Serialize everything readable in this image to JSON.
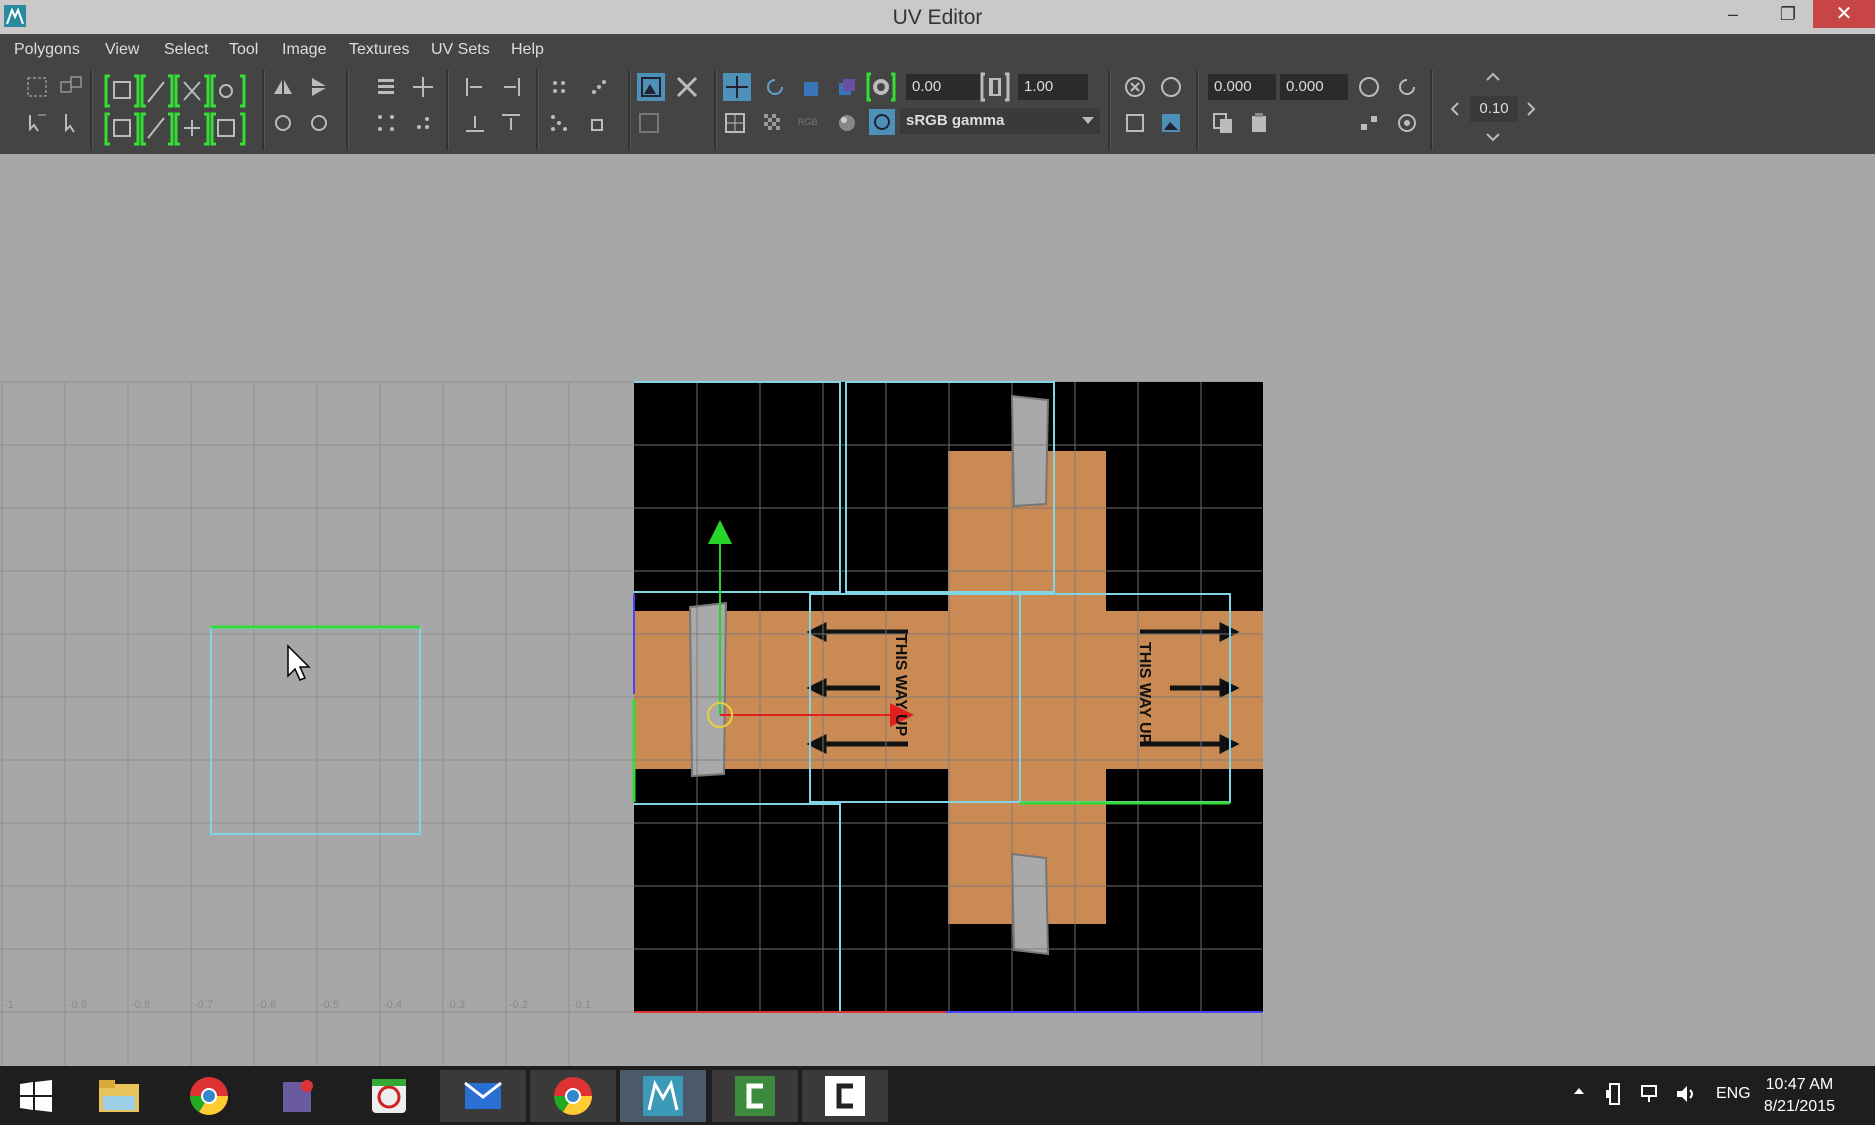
{
  "window": {
    "title": "UV Editor",
    "minimize": "–",
    "restore": "❐",
    "close": "✕"
  },
  "menu": [
    "Polygons",
    "View",
    "Select",
    "Tool",
    "Image",
    "Textures",
    "UV Sets",
    "Help"
  ],
  "toolbar": {
    "exposure_value": "0.00",
    "gamma_value": "1.00",
    "color_space": "sRGB gamma",
    "u_value": "0.000",
    "v_value": "0.000",
    "step_value": "0.10",
    "rgb_label": "RGB"
  },
  "grid": {
    "axis_labels": [
      "-1",
      "-0.9",
      "-0.8",
      "-0.7",
      "-0.6",
      "-0.5",
      "-0.4",
      "-0.3",
      "-0.2",
      "-0.1"
    ]
  },
  "texture": {
    "label_1": "THIS WAY UP",
    "label_2": "THIS WAY UP"
  },
  "colors": {
    "cardboard": "#c98a54",
    "uv_border": "#7fd4e6",
    "selected_edge": "#37d837",
    "manip_y": "#29d429",
    "manip_x": "#e02020",
    "manip_center": "#e7d040"
  },
  "taskbar": {
    "apps": [
      "start-icon",
      "file-explorer-icon",
      "chrome-icon",
      "photoshop-icon",
      "screen-recorder-icon",
      "mail-icon",
      "chrome-icon",
      "maya-icon",
      "camtasia-icon",
      "camtasia-recorder-icon"
    ],
    "language": "ENG",
    "time": "10:47 AM",
    "date": "8/21/2015"
  }
}
